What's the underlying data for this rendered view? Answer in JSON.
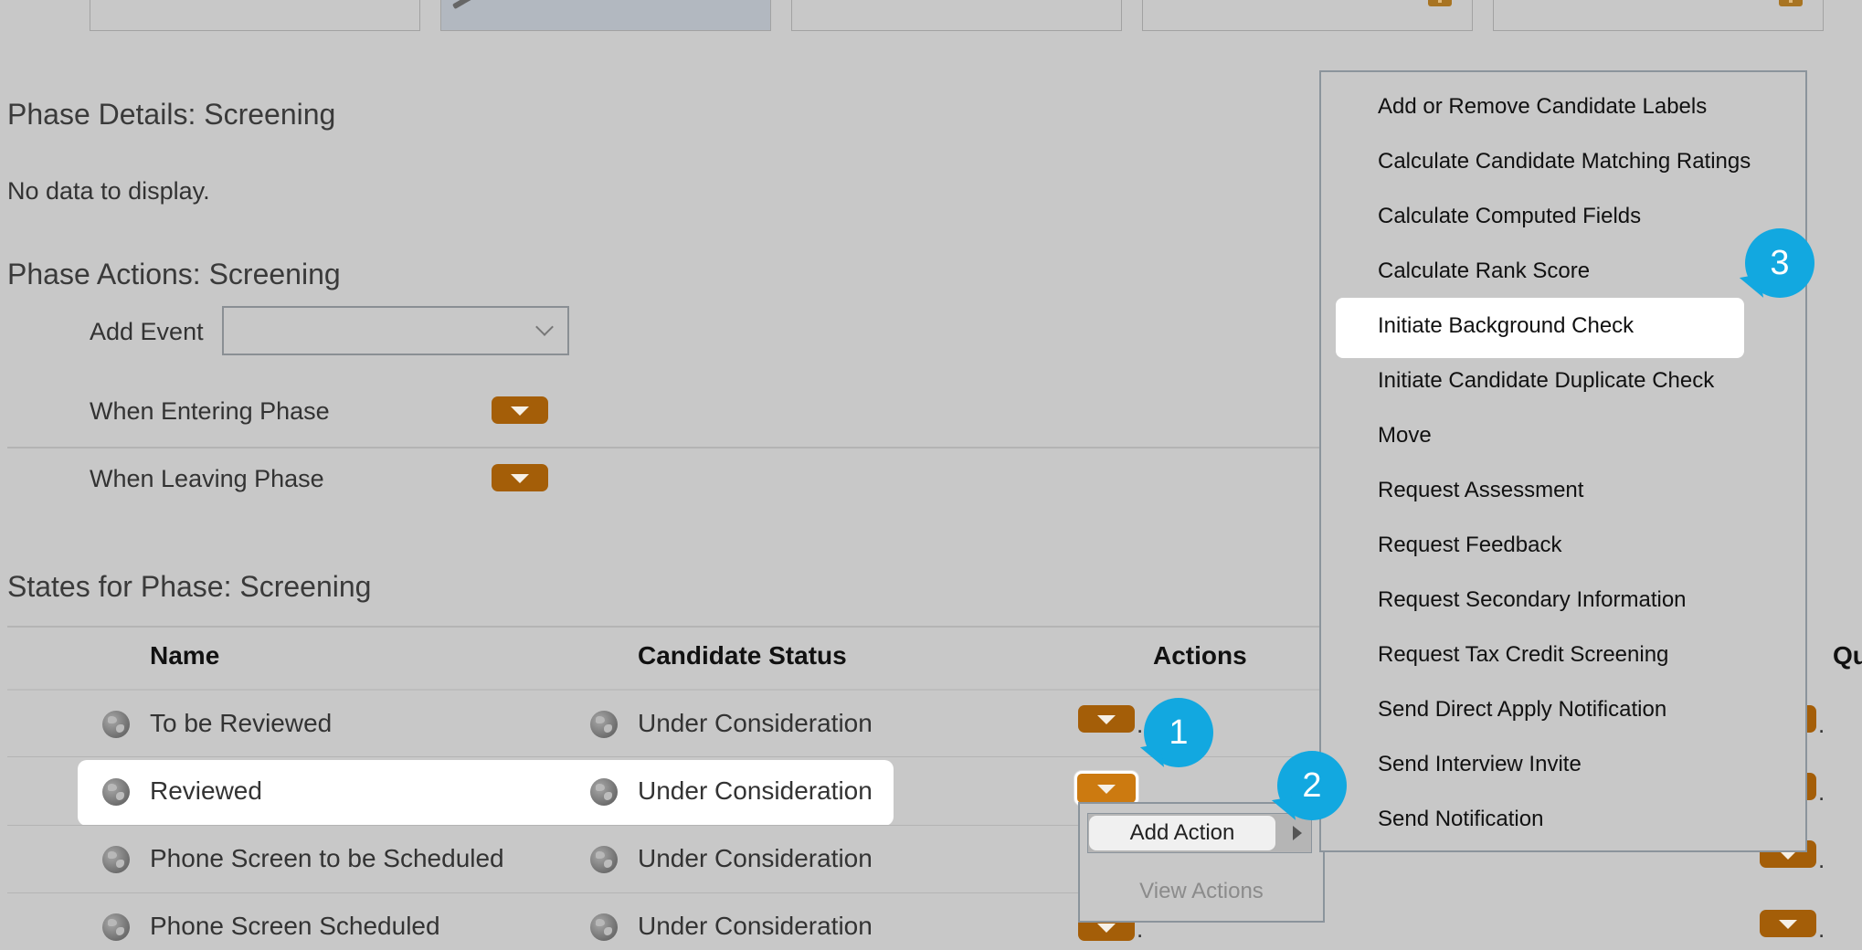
{
  "phase_details": {
    "title": "Phase Details: Screening",
    "empty_message": "No data to display."
  },
  "phase_actions": {
    "title": "Phase Actions: Screening",
    "add_event_label": "Add Event",
    "add_event_value": "",
    "when_entering_label": "When Entering Phase",
    "when_leaving_label": "When Leaving Phase"
  },
  "states": {
    "title": "States for Phase: Screening",
    "columns": {
      "name": "Name",
      "candidate_status": "Candidate Status",
      "actions": "Actions",
      "qu": "Qu"
    },
    "rows": [
      {
        "name": "To be Reviewed",
        "status": "Under Consideration"
      },
      {
        "name": "Reviewed",
        "status": "Under Consideration"
      },
      {
        "name": "Phone Screen to be Scheduled",
        "status": "Under Consideration"
      },
      {
        "name": "Phone Screen Scheduled",
        "status": "Under Consideration"
      }
    ]
  },
  "context_menu": {
    "add_action": "Add Action",
    "view_actions": "View Actions"
  },
  "submenu": {
    "items": [
      "Add or Remove Candidate Labels",
      "Calculate Candidate Matching Ratings",
      "Calculate Computed Fields",
      "Calculate Rank Score",
      "Initiate Background Check",
      "Initiate Candidate Duplicate Check",
      "Move",
      "Request Assessment",
      "Request Feedback",
      "Request Secondary Information",
      "Request Tax Credit Screening",
      "Send Direct Apply Notification",
      "Send Interview Invite",
      "Send Notification"
    ]
  },
  "callouts": {
    "c1": "1",
    "c2": "2",
    "c3": "3"
  },
  "misc": {
    "dot": "."
  },
  "colors": {
    "background": "#c8c8c8",
    "menu_button": "#a45e08",
    "callout": "#12a8e0",
    "highlight": "#ffffff"
  }
}
